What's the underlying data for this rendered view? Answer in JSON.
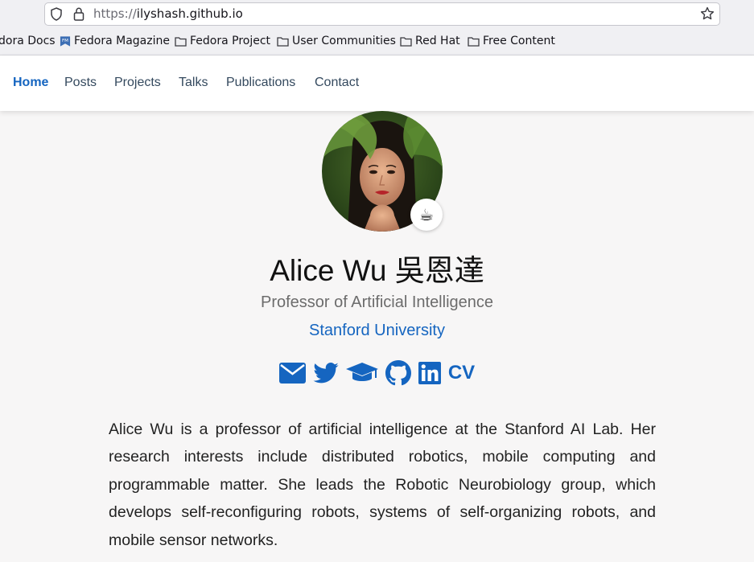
{
  "browser": {
    "url_scheme": "https://",
    "url_host": "ilyshash.github.io",
    "bookmarks": [
      {
        "label": "dora Docs",
        "icon": "folder-icon"
      },
      {
        "label": "Fedora Magazine",
        "icon": "fedora-magazine-icon"
      },
      {
        "label": "Fedora Project",
        "icon": "folder-icon"
      },
      {
        "label": "User Communities",
        "icon": "folder-icon"
      },
      {
        "label": "Red Hat",
        "icon": "folder-icon"
      },
      {
        "label": "Free Content",
        "icon": "folder-icon"
      }
    ]
  },
  "nav": {
    "items": [
      {
        "label": "Home",
        "active": true
      },
      {
        "label": "Posts"
      },
      {
        "label": "Projects"
      },
      {
        "label": "Talks"
      },
      {
        "label": "Publications"
      },
      {
        "label": "Contact"
      }
    ]
  },
  "profile": {
    "status_emoji": "☕",
    "name": "Alice Wu 吳恩達",
    "role": "Professor of Artificial Intelligence",
    "organization": "Stanford University",
    "socials": [
      "envelope-icon",
      "twitter-icon",
      "graduation-cap-icon",
      "github-icon",
      "linkedin-icon"
    ],
    "cv_label": "CV",
    "bio": "Alice Wu is a professor of artificial intelligence at the Stanford AI Lab. Her research interests include distributed robotics, mobile computing and programmable matter. She leads the Robotic Neurobiology group, which develops self-reconfiguring robots, systems of self-organizing robots, and mobile sensor networks."
  },
  "colors": {
    "accent": "#1565c0",
    "text": "#222222",
    "muted": "#6c6c6c",
    "background": "#f7f6f6"
  }
}
